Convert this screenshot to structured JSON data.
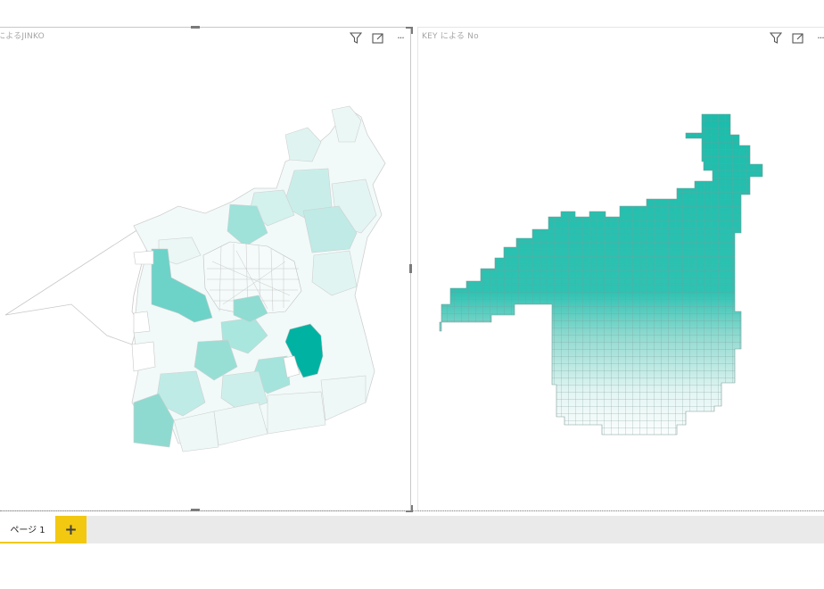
{
  "visuals": {
    "left": {
      "title": "によるJINKO",
      "more": "···"
    },
    "right": {
      "title": "KEY による No",
      "more": "···"
    }
  },
  "pages": {
    "tab_label": "ページ 1",
    "add_label": "+"
  },
  "icons": [
    "filter-icon",
    "focus-mode-icon",
    "more-options-icon"
  ],
  "colors": {
    "accent": "#f2c811",
    "map_dark": "#00b2a2",
    "map_mid": "#7fd9d0",
    "map_light": "#e6f6f4",
    "grid_top": "#1bbcab",
    "grid_bottom": "#ffffff"
  }
}
